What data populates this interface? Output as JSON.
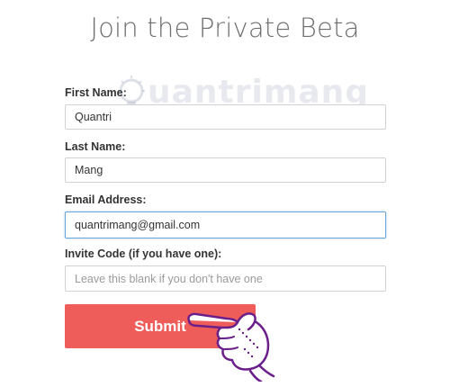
{
  "page": {
    "title": "Join the Private Beta"
  },
  "watermark": {
    "text": "uantrimang"
  },
  "form": {
    "first_name": {
      "label": "First Name:",
      "value": "Quantri"
    },
    "last_name": {
      "label": "Last Name:",
      "value": "Mang"
    },
    "email": {
      "label": "Email Address:",
      "value": "quantrimang@gmail.com"
    },
    "invite_code": {
      "label": "Invite Code (if you have one):",
      "value": "",
      "placeholder": "Leave this blank if you don't have one"
    },
    "submit_label": "Submit"
  },
  "colors": {
    "accent": "#ef5d5b",
    "focus_border": "#6aa6d8"
  },
  "icons": [
    "pointing-hand-cursor-icon",
    "lightbulb-logo-icon"
  ]
}
